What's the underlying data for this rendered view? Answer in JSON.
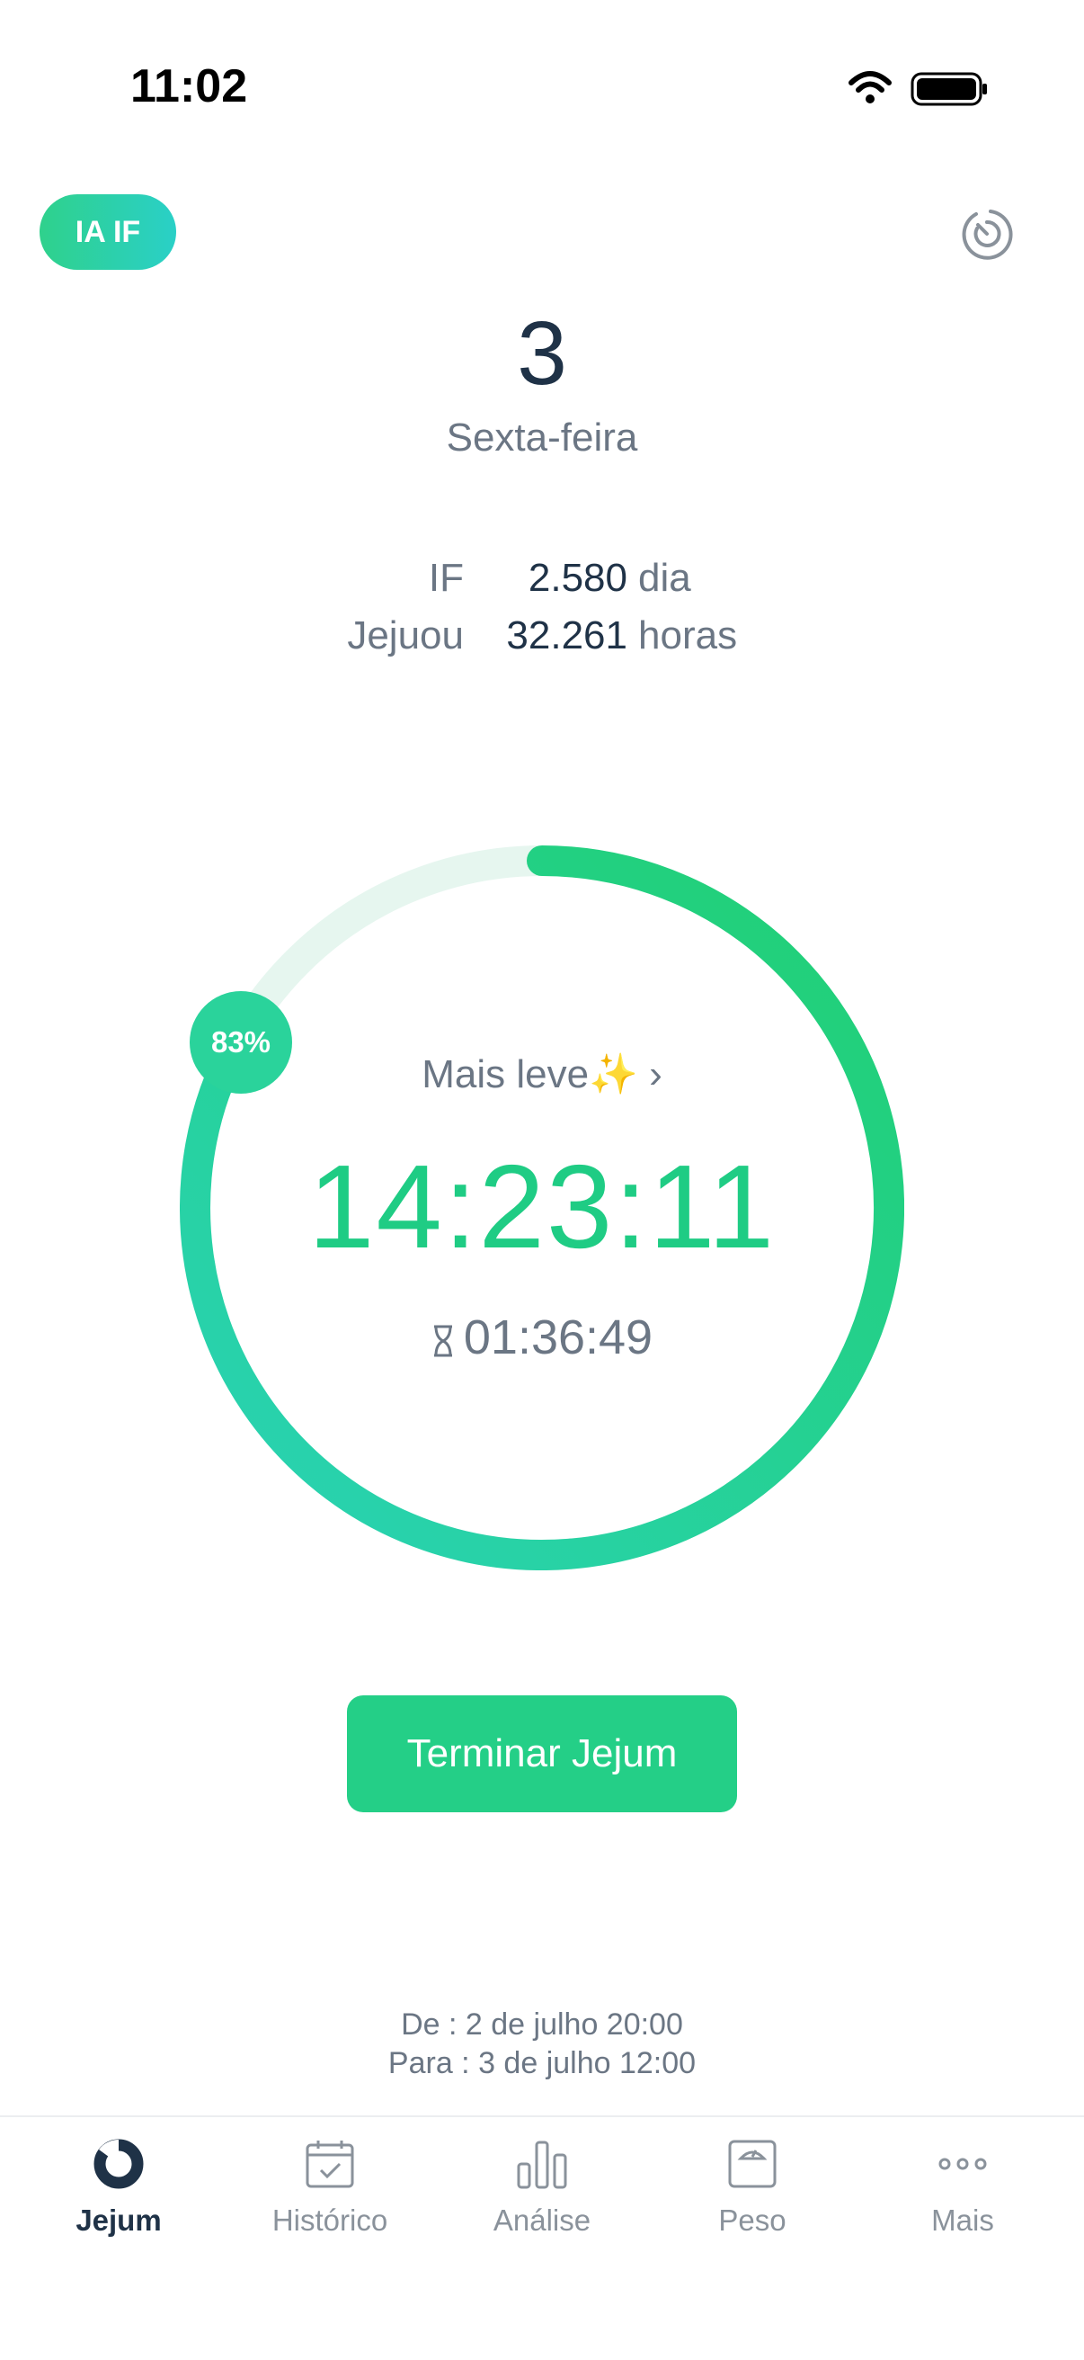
{
  "status_bar": {
    "time": "11:02"
  },
  "header": {
    "badge": "IA IF"
  },
  "day": {
    "number": "3",
    "name": "Sexta-feira"
  },
  "stats": [
    {
      "label": "IF",
      "value": "2.580",
      "unit": "dia"
    },
    {
      "label": "Jejuou",
      "value": "32.261",
      "unit": "horas"
    }
  ],
  "timer": {
    "progress_percent": 83,
    "progress_label": "83%",
    "mood": "Mais leve✨ ›",
    "elapsed": "14:23:11",
    "remaining": "01:36:49"
  },
  "action": {
    "end_label": "Terminar Jejum"
  },
  "schedule": {
    "from": "De : 2 de julho 20:00",
    "to": "Para : 3 de julho 12:00"
  },
  "tabs": [
    {
      "label": "Jejum",
      "icon": "fasting-icon",
      "active": true
    },
    {
      "label": "Histórico",
      "icon": "calendar-icon",
      "active": false
    },
    {
      "label": "Análise",
      "icon": "bar-chart-icon",
      "active": false
    },
    {
      "label": "Peso",
      "icon": "scale-icon",
      "active": false
    },
    {
      "label": "Mais",
      "icon": "more-icon",
      "active": false
    }
  ],
  "colors": {
    "accent": "#24cf87",
    "accent_teal": "#2ad0c7",
    "text_dark": "#1f3247",
    "text_muted": "#6b7684"
  }
}
